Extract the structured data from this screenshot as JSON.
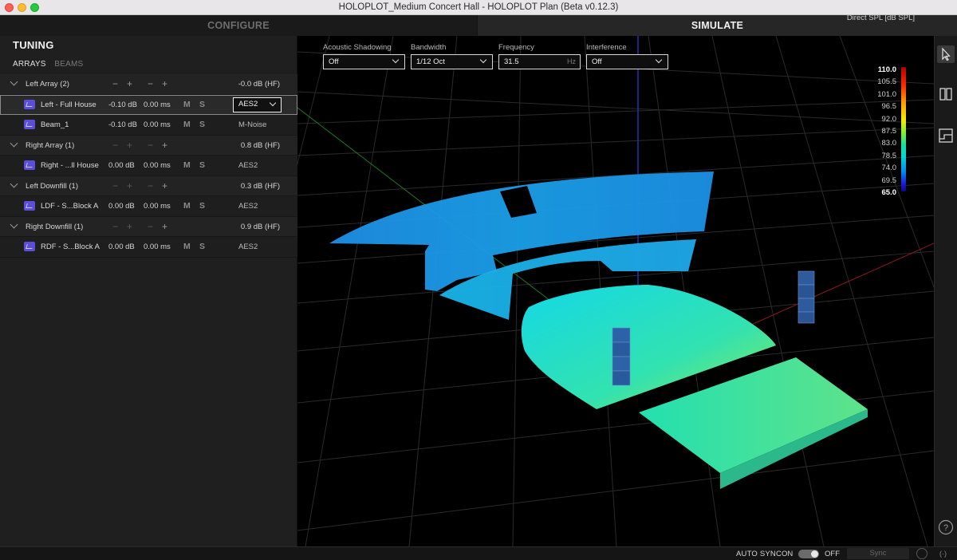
{
  "window": {
    "title": "HOLOPLOT_Medium Concert Hall - HOLOPLOT Plan (Beta v0.12.3)"
  },
  "modes": {
    "configure": "CONFIGURE",
    "simulate": "SIMULATE"
  },
  "sidebar": {
    "title": "TUNING",
    "tabs": [
      "ARRAYS",
      "BEAMS"
    ],
    "controls": {
      "minus": "−",
      "plus": "+",
      "mute": "M",
      "solo": "S"
    },
    "groups": [
      {
        "name": "Left Array (2)",
        "gain": "-0.0 dB (HF)",
        "items": [
          {
            "name": "Left - Full House",
            "db": "-0.10 dB",
            "ms": "0.00 ms",
            "proc": "AES2",
            "selected": true
          },
          {
            "name": "Beam_1",
            "db": "-0.10 dB",
            "ms": "0.00 ms",
            "proc": "M-Noise"
          }
        ]
      },
      {
        "name": "Right Array (1)",
        "gain": "0.8 dB (HF)",
        "items": [
          {
            "name": "Right - ...ll House",
            "db": "0.00 dB",
            "ms": "0.00 ms",
            "proc": "AES2"
          }
        ]
      },
      {
        "name": "Left Downfill (1)",
        "gain": "0.3 dB (HF)",
        "items": [
          {
            "name": "LDF - S...Block A",
            "db": "0.00 dB",
            "ms": "0.00 ms",
            "proc": "AES2"
          }
        ]
      },
      {
        "name": "Right Downfill (1)",
        "gain": "0.9 dB (HF)",
        "items": [
          {
            "name": "RDF - S...Block A",
            "db": "0.00 dB",
            "ms": "0.00 ms",
            "proc": "AES2"
          }
        ]
      }
    ]
  },
  "toolbar": {
    "acoustic_shadowing": {
      "label": "Acoustic Shadowing",
      "value": "Off"
    },
    "bandwidth": {
      "label": "Bandwidth",
      "value": "1/12 Oct"
    },
    "frequency": {
      "label": "Frequency",
      "value": "31.5",
      "unit": "Hz"
    },
    "interference": {
      "label": "Interference",
      "value": "Off"
    }
  },
  "legend": {
    "title": "Direct SPL [dB SPL]",
    "labels": [
      "110.0",
      "105.5",
      "101.0",
      "96.5",
      "92.0",
      "87.5",
      "83.0",
      "78.5",
      "74.0",
      "69.5",
      "65.0"
    ]
  },
  "rightbar": {
    "icons": [
      "cursor-icon",
      "split-view-icon",
      "layout-icon",
      "help-icon"
    ],
    "help_label": "?"
  },
  "status": {
    "autosync": "AUTO SYNC",
    "on": "ON",
    "off": "OFF",
    "sync": "Sync",
    "broadcast": "(·)"
  }
}
